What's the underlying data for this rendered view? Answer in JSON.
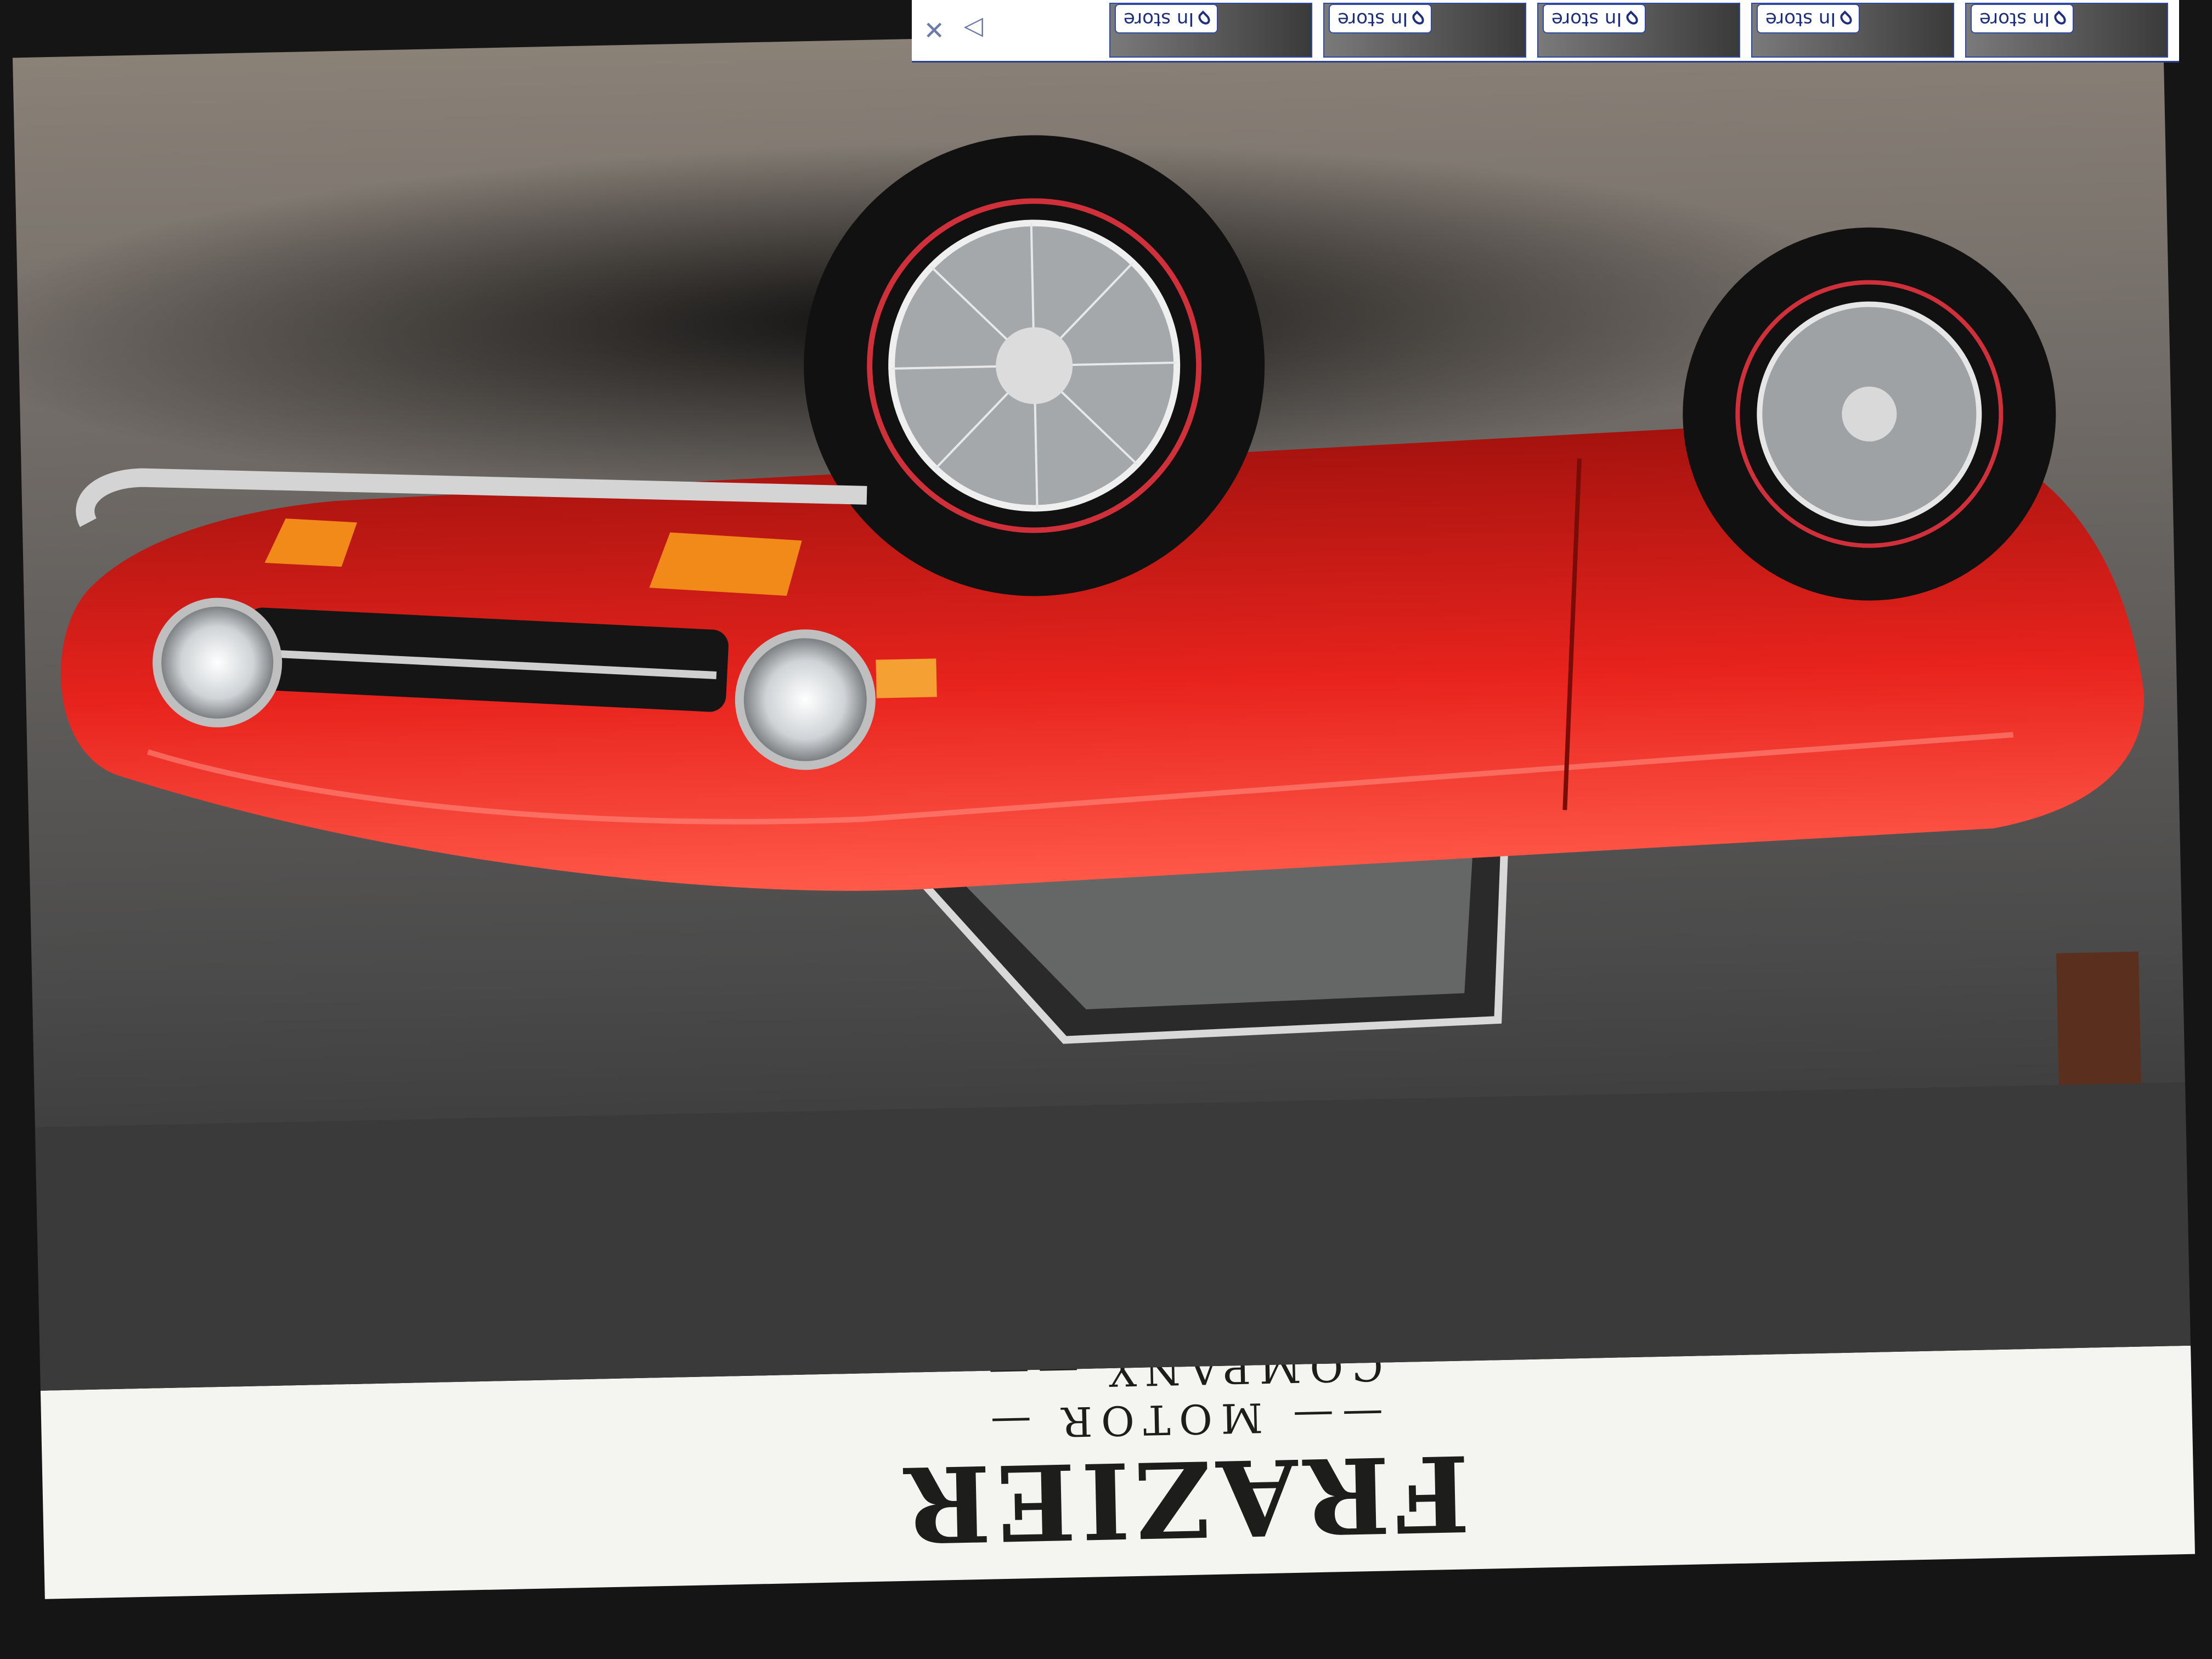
{
  "site": {
    "logo_main": "FRAZIER",
    "logo_sub": "COMPANY",
    "logo_partial": "MOTOR"
  },
  "thumbnails": [
    {
      "badge": "In store"
    },
    {
      "badge": "In store"
    },
    {
      "badge": "In store"
    },
    {
      "badge": "In store"
    },
    {
      "badge": "In store"
    }
  ],
  "controls": {
    "close_icon": "close-icon",
    "adchoices_icon": "adchoices-triangle-icon"
  },
  "colors": {
    "car_body": "#e8231d",
    "banner_bg": "#f4f4f1",
    "badge_blue": "#2f4aa0"
  }
}
